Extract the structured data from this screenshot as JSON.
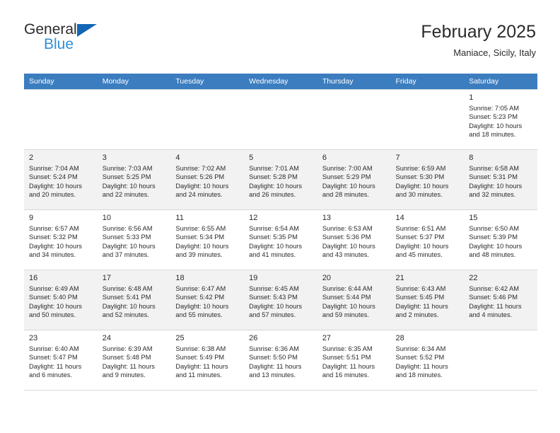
{
  "brand": {
    "name_top": "General",
    "name_bottom": "Blue",
    "triangle_color": "#1266b4",
    "bottom_color": "#2f8fd8"
  },
  "header": {
    "title": "February 2025",
    "subtitle": "Maniace, Sicily, Italy"
  },
  "theme": {
    "header_row_bg": "#3b7dbf",
    "header_row_text": "#ffffff",
    "shaded_row_bg": "#f2f2f2",
    "grid_line": "#d8d8d8",
    "text": "#2b2b2b"
  },
  "weekdays": [
    "Sunday",
    "Monday",
    "Tuesday",
    "Wednesday",
    "Thursday",
    "Friday",
    "Saturday"
  ],
  "weeks": [
    {
      "shaded": false,
      "days": [
        {
          "day": "",
          "detail": ""
        },
        {
          "day": "",
          "detail": ""
        },
        {
          "day": "",
          "detail": ""
        },
        {
          "day": "",
          "detail": ""
        },
        {
          "day": "",
          "detail": ""
        },
        {
          "day": "",
          "detail": ""
        },
        {
          "day": "1",
          "detail": "Sunrise: 7:05 AM\nSunset: 5:23 PM\nDaylight: 10 hours\nand 18 minutes."
        }
      ]
    },
    {
      "shaded": true,
      "days": [
        {
          "day": "2",
          "detail": "Sunrise: 7:04 AM\nSunset: 5:24 PM\nDaylight: 10 hours\nand 20 minutes."
        },
        {
          "day": "3",
          "detail": "Sunrise: 7:03 AM\nSunset: 5:25 PM\nDaylight: 10 hours\nand 22 minutes."
        },
        {
          "day": "4",
          "detail": "Sunrise: 7:02 AM\nSunset: 5:26 PM\nDaylight: 10 hours\nand 24 minutes."
        },
        {
          "day": "5",
          "detail": "Sunrise: 7:01 AM\nSunset: 5:28 PM\nDaylight: 10 hours\nand 26 minutes."
        },
        {
          "day": "6",
          "detail": "Sunrise: 7:00 AM\nSunset: 5:29 PM\nDaylight: 10 hours\nand 28 minutes."
        },
        {
          "day": "7",
          "detail": "Sunrise: 6:59 AM\nSunset: 5:30 PM\nDaylight: 10 hours\nand 30 minutes."
        },
        {
          "day": "8",
          "detail": "Sunrise: 6:58 AM\nSunset: 5:31 PM\nDaylight: 10 hours\nand 32 minutes."
        }
      ]
    },
    {
      "shaded": false,
      "days": [
        {
          "day": "9",
          "detail": "Sunrise: 6:57 AM\nSunset: 5:32 PM\nDaylight: 10 hours\nand 34 minutes."
        },
        {
          "day": "10",
          "detail": "Sunrise: 6:56 AM\nSunset: 5:33 PM\nDaylight: 10 hours\nand 37 minutes."
        },
        {
          "day": "11",
          "detail": "Sunrise: 6:55 AM\nSunset: 5:34 PM\nDaylight: 10 hours\nand 39 minutes."
        },
        {
          "day": "12",
          "detail": "Sunrise: 6:54 AM\nSunset: 5:35 PM\nDaylight: 10 hours\nand 41 minutes."
        },
        {
          "day": "13",
          "detail": "Sunrise: 6:53 AM\nSunset: 5:36 PM\nDaylight: 10 hours\nand 43 minutes."
        },
        {
          "day": "14",
          "detail": "Sunrise: 6:51 AM\nSunset: 5:37 PM\nDaylight: 10 hours\nand 45 minutes."
        },
        {
          "day": "15",
          "detail": "Sunrise: 6:50 AM\nSunset: 5:39 PM\nDaylight: 10 hours\nand 48 minutes."
        }
      ]
    },
    {
      "shaded": true,
      "days": [
        {
          "day": "16",
          "detail": "Sunrise: 6:49 AM\nSunset: 5:40 PM\nDaylight: 10 hours\nand 50 minutes."
        },
        {
          "day": "17",
          "detail": "Sunrise: 6:48 AM\nSunset: 5:41 PM\nDaylight: 10 hours\nand 52 minutes."
        },
        {
          "day": "18",
          "detail": "Sunrise: 6:47 AM\nSunset: 5:42 PM\nDaylight: 10 hours\nand 55 minutes."
        },
        {
          "day": "19",
          "detail": "Sunrise: 6:45 AM\nSunset: 5:43 PM\nDaylight: 10 hours\nand 57 minutes."
        },
        {
          "day": "20",
          "detail": "Sunrise: 6:44 AM\nSunset: 5:44 PM\nDaylight: 10 hours\nand 59 minutes."
        },
        {
          "day": "21",
          "detail": "Sunrise: 6:43 AM\nSunset: 5:45 PM\nDaylight: 11 hours\nand 2 minutes."
        },
        {
          "day": "22",
          "detail": "Sunrise: 6:42 AM\nSunset: 5:46 PM\nDaylight: 11 hours\nand 4 minutes."
        }
      ]
    },
    {
      "shaded": false,
      "days": [
        {
          "day": "23",
          "detail": "Sunrise: 6:40 AM\nSunset: 5:47 PM\nDaylight: 11 hours\nand 6 minutes."
        },
        {
          "day": "24",
          "detail": "Sunrise: 6:39 AM\nSunset: 5:48 PM\nDaylight: 11 hours\nand 9 minutes."
        },
        {
          "day": "25",
          "detail": "Sunrise: 6:38 AM\nSunset: 5:49 PM\nDaylight: 11 hours\nand 11 minutes."
        },
        {
          "day": "26",
          "detail": "Sunrise: 6:36 AM\nSunset: 5:50 PM\nDaylight: 11 hours\nand 13 minutes."
        },
        {
          "day": "27",
          "detail": "Sunrise: 6:35 AM\nSunset: 5:51 PM\nDaylight: 11 hours\nand 16 minutes."
        },
        {
          "day": "28",
          "detail": "Sunrise: 6:34 AM\nSunset: 5:52 PM\nDaylight: 11 hours\nand 18 minutes."
        },
        {
          "day": "",
          "detail": ""
        }
      ]
    }
  ]
}
